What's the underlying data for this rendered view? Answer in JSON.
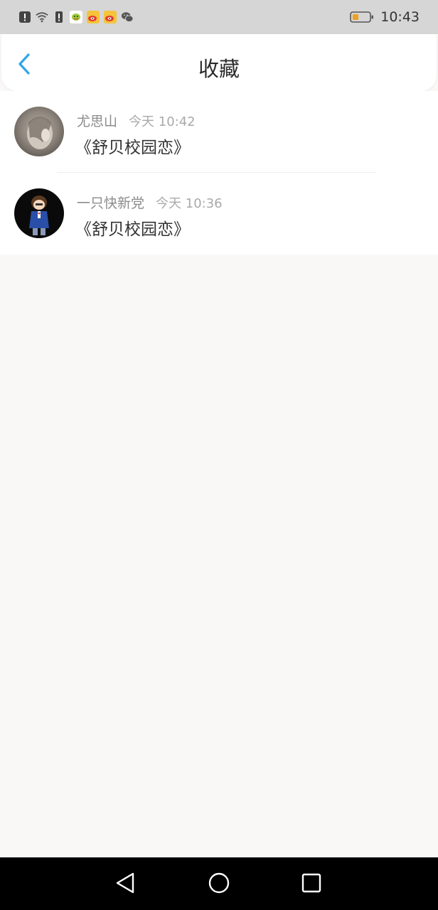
{
  "status_bar": {
    "time": "10:43",
    "icons": [
      "alert-icon",
      "wifi-icon",
      "sim-alert-icon",
      "chat-app-icon",
      "weibo-icon",
      "weibo-icon",
      "wechat-icon"
    ],
    "battery_color": "#f0a020"
  },
  "header": {
    "title": "收藏",
    "back_icon": "chevron-left-icon",
    "accent_color": "#2fa6e6"
  },
  "favorites": [
    {
      "username": "尤思山",
      "time": "今天 10:42",
      "title": "《舒贝校园恋》"
    },
    {
      "username": "一只快新党",
      "time": "今天 10:36",
      "title": "《舒贝校园恋》"
    }
  ],
  "nav_bar": {
    "buttons": [
      "back-triangle-icon",
      "home-circle-icon",
      "recents-square-icon"
    ]
  }
}
